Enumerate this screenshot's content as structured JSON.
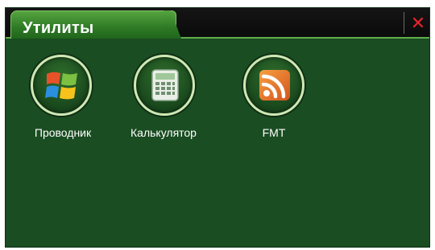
{
  "window": {
    "title": "Утилиты",
    "close_symbol": "✕"
  },
  "apps": [
    {
      "label": "Проводник",
      "icon": "windows-explorer-icon"
    },
    {
      "label": "Калькулятор",
      "icon": "calculator-icon"
    },
    {
      "label": "FMT",
      "icon": "rss-feed-icon"
    }
  ],
  "colors": {
    "background": "#1a4d22",
    "tab_accent": "#4a9c3a",
    "close": "#e8242a"
  }
}
